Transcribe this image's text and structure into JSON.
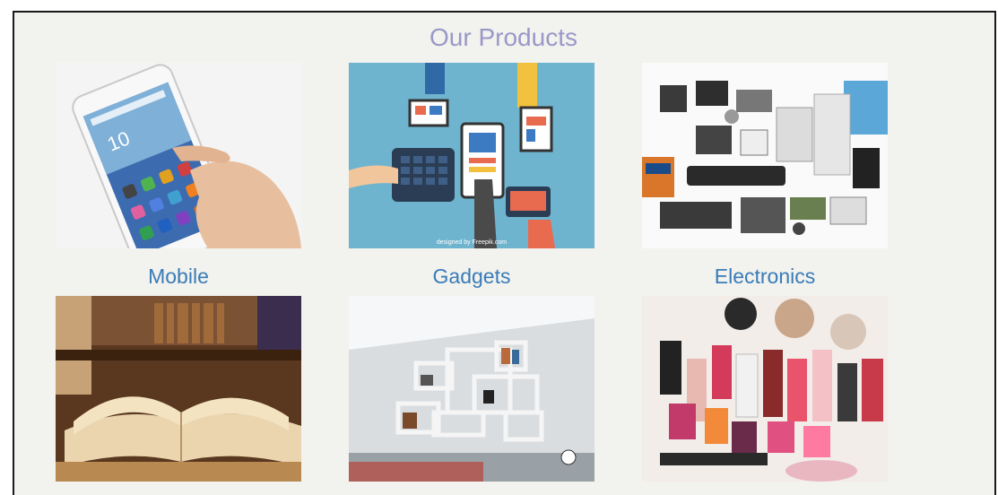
{
  "section": {
    "title": "Our Products"
  },
  "products": [
    {
      "label": "Mobile"
    },
    {
      "label": "Gadgets"
    },
    {
      "label": "Electronics"
    }
  ],
  "colors": {
    "frame_bg": "#f2f2ee",
    "title": "#9a98c8",
    "caption": "#3a7cb8"
  },
  "images": {
    "gadgets_credit": "designed by Freepik.com"
  }
}
